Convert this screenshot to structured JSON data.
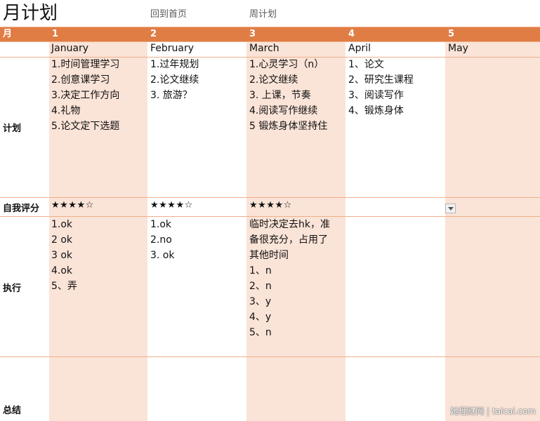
{
  "page": {
    "title": "月计划",
    "links": {
      "home": "回到首页",
      "weekly": "周计划"
    }
  },
  "header": {
    "first": "月",
    "numbers": [
      "1",
      "2",
      "3",
      "4",
      "5"
    ]
  },
  "months": [
    "January",
    "February",
    "March",
    "April",
    "May"
  ],
  "labels": {
    "plan": "计划",
    "rating": "自我评分",
    "execution": "执行",
    "summary": "总结"
  },
  "plans": [
    [
      "1.时间管理学习",
      "2.创意课学习",
      "3.决定工作方向",
      "4.礼物",
      "5.论文定下选题"
    ],
    [
      "1.过年规划",
      "2.论文继续",
      "3. 旅游？"
    ],
    [
      "1.心灵学习（n）",
      "2.论文继续",
      "3. 上课，节奏",
      "4.阅读写作继续",
      "5 锻炼身体坚持住"
    ],
    [
      "1、论文",
      "2、研究生课程",
      "3、阅读写作",
      "4、锻炼身体"
    ]
  ],
  "ratings": [
    "★★★★☆",
    "★★★★☆",
    "★★★★☆"
  ],
  "execution": [
    [
      "1.ok",
      "2 ok",
      "3 ok",
      "4.ok",
      "5、弄"
    ],
    [
      "1.ok",
      "2.no",
      "3. ok"
    ],
    [
      "临时决定去hk，准",
      "备很充分，占用了",
      "其他时间",
      "1、n",
      "2、n",
      "3、y",
      "4、y",
      "5、n"
    ]
  ],
  "watermark": "她理财网 | taicai.com"
}
